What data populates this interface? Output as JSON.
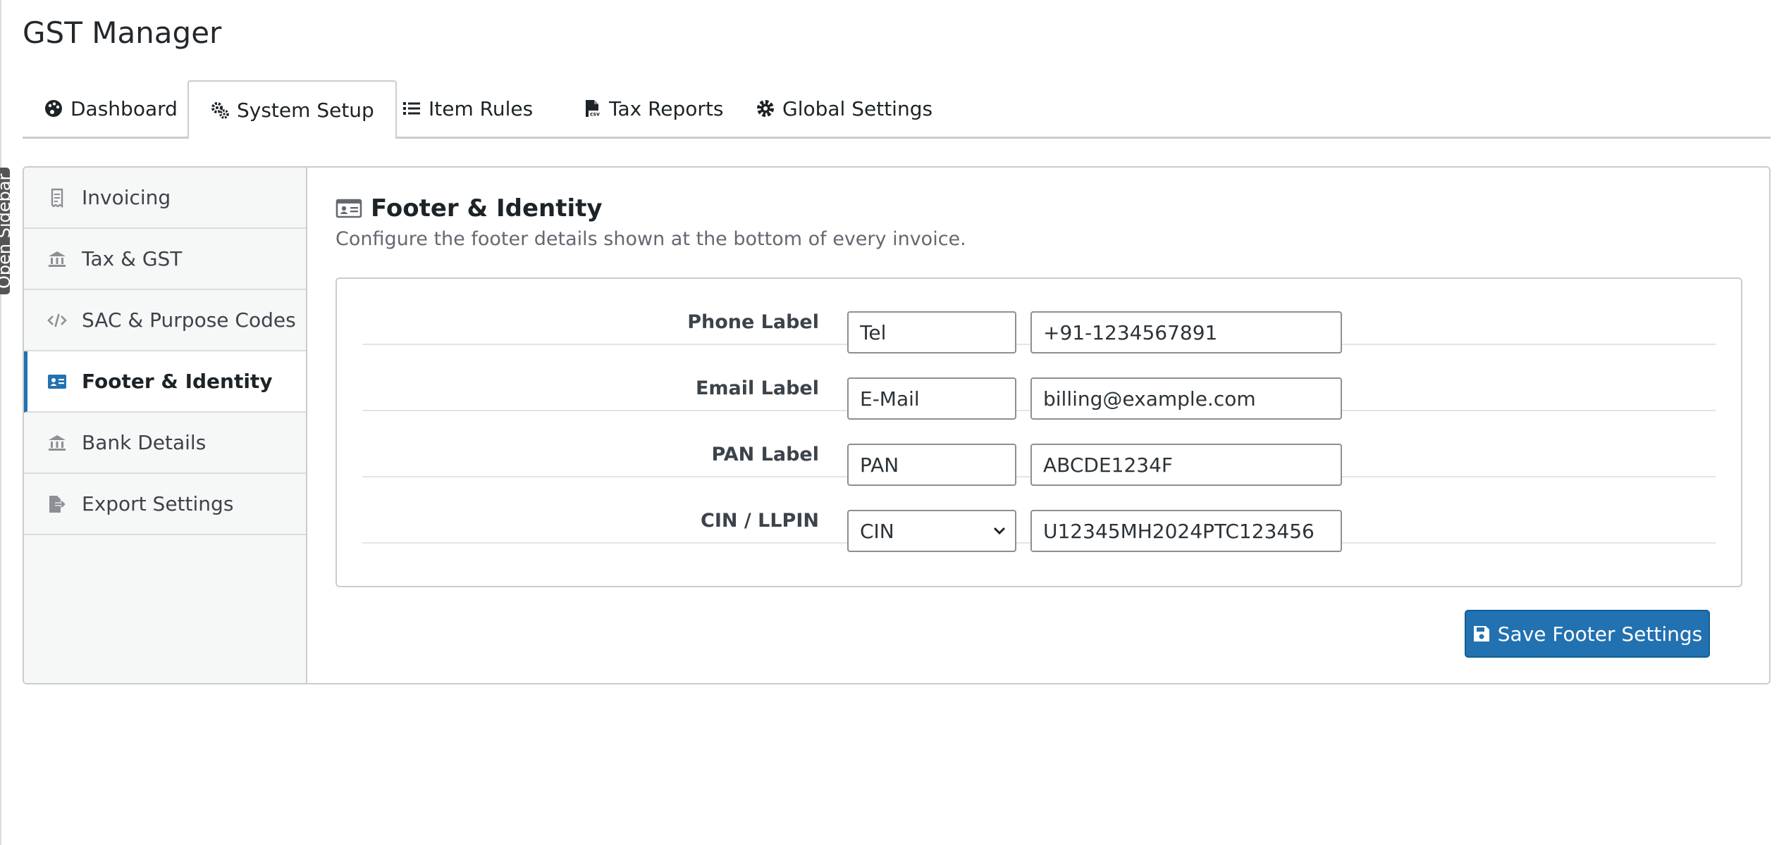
{
  "app": {
    "title": "GST Manager",
    "sidebar_toggle_label": "Open Sidebar"
  },
  "tabs": [
    {
      "label": "Dashboard",
      "icon": "palette-icon",
      "active": false
    },
    {
      "label": "System Setup",
      "icon": "gears-icon",
      "active": true
    },
    {
      "label": "Item Rules",
      "icon": "list-icon",
      "active": false
    },
    {
      "label": "Tax Reports",
      "icon": "csv-file-icon",
      "active": false
    },
    {
      "label": "Global Settings",
      "icon": "gear-icon",
      "active": false
    }
  ],
  "sidebar": {
    "items": [
      {
        "label": "Invoicing",
        "icon": "receipt-icon",
        "active": false
      },
      {
        "label": "Tax & GST",
        "icon": "bank-icon",
        "active": false
      },
      {
        "label": "SAC & Purpose Codes",
        "icon": "code-icon",
        "active": false
      },
      {
        "label": "Footer & Identity",
        "icon": "id-card-icon",
        "active": true
      },
      {
        "label": "Bank Details",
        "icon": "bank-icon",
        "active": false
      },
      {
        "label": "Export Settings",
        "icon": "file-export-icon",
        "active": false
      }
    ]
  },
  "section": {
    "title": "Footer & Identity",
    "description": "Configure the footer details shown at the bottom of every invoice."
  },
  "form": {
    "rows": [
      {
        "label": "Phone Label",
        "short_value": "Tel",
        "long_value": "+91-1234567891"
      },
      {
        "label": "Email Label",
        "short_value": "E-Mail",
        "long_value": "billing@example.com"
      },
      {
        "label": "PAN Label",
        "short_value": "PAN",
        "long_value": "ABCDE1234F"
      },
      {
        "label": "CIN / LLPIN",
        "select_value": "CIN",
        "long_value": "U12345MH2024PTC123456"
      }
    ]
  },
  "actions": {
    "save_label": "Save Footer Settings"
  },
  "colors": {
    "accent": "#2271b1",
    "border": "#cccccc",
    "nav_background": "#f6f7f7"
  }
}
